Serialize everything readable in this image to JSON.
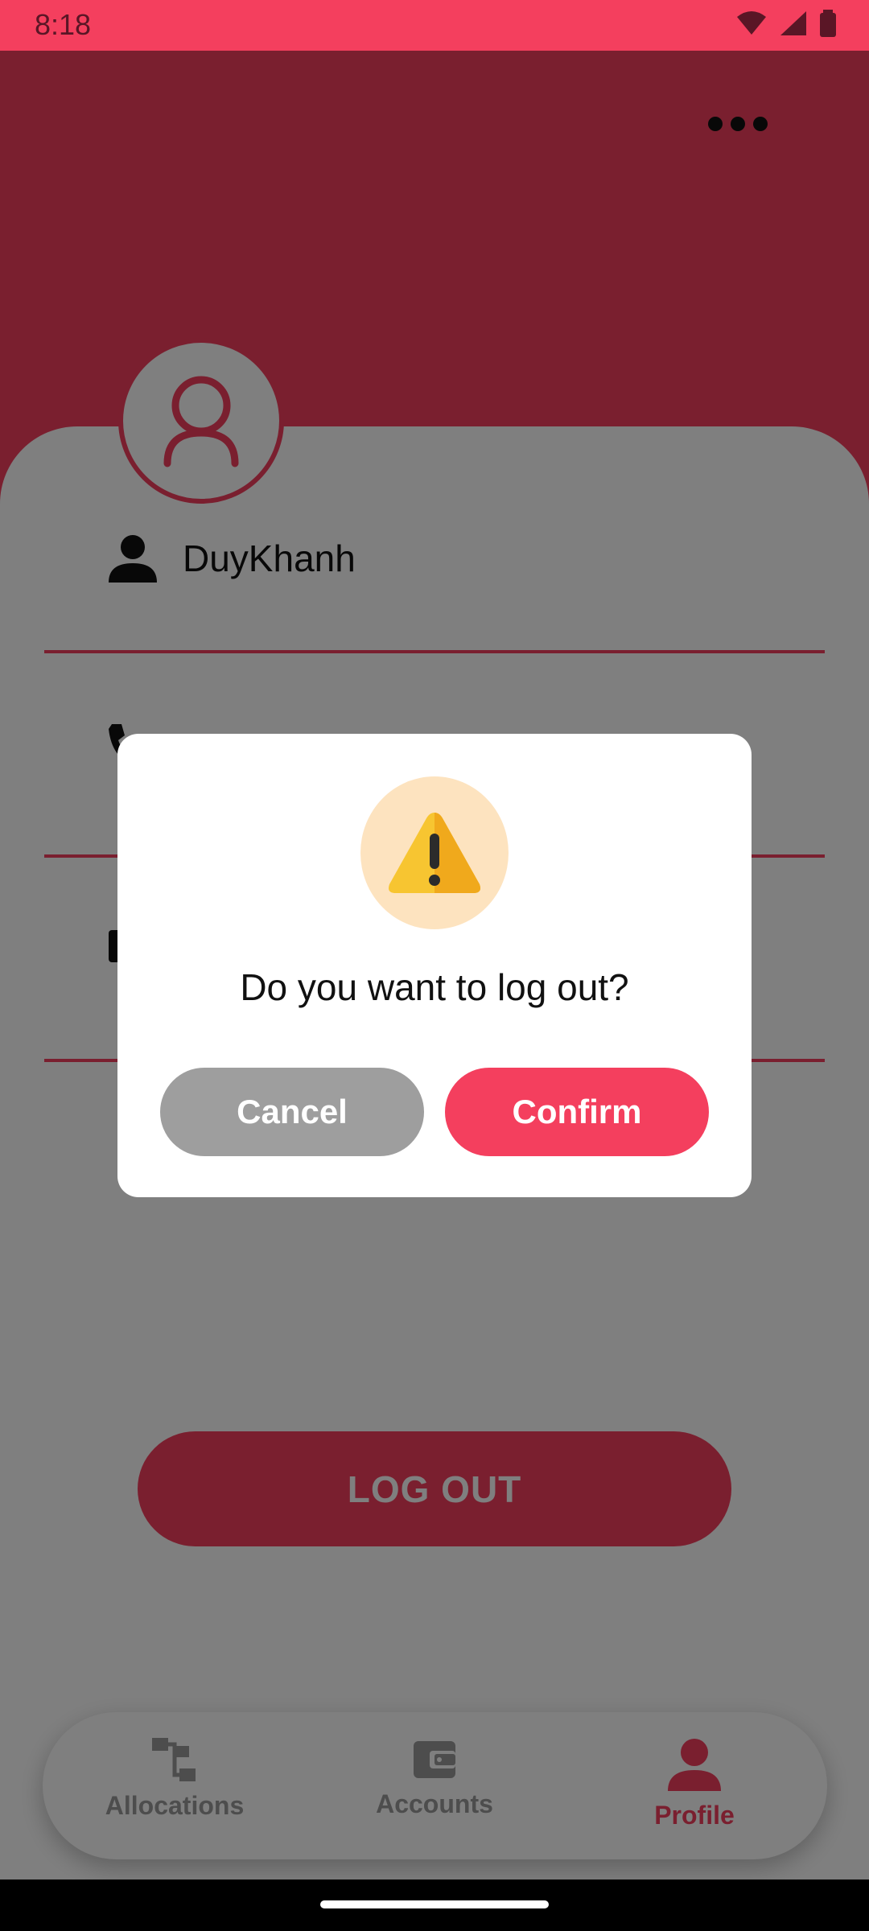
{
  "status_bar": {
    "time": "8:18"
  },
  "profile": {
    "username": "DuyKhanh",
    "logout_label": "LOG OUT"
  },
  "bottom_nav": {
    "items": [
      {
        "label": "Allocations",
        "icon": "allocation-tree-icon",
        "active": false
      },
      {
        "label": "Accounts",
        "icon": "wallet-icon",
        "active": false
      },
      {
        "label": "Profile",
        "icon": "person-icon",
        "active": true
      }
    ]
  },
  "dialog": {
    "icon": "warning-icon",
    "question": "Do you want to log out?",
    "cancel_label": "Cancel",
    "confirm_label": "Confirm"
  },
  "colors": {
    "accent": "#f43f5e",
    "cancel": "#9e9e9e",
    "warning_bg": "#fde3bf"
  }
}
